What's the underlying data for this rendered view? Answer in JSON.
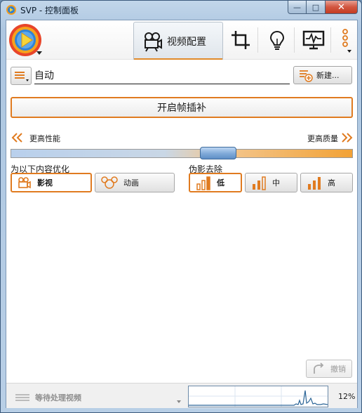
{
  "window": {
    "title": "SVP - 控制面板",
    "buttons": {
      "minimize": "—",
      "maximize": "□",
      "close": "✕"
    }
  },
  "header": {
    "active_tab": "视频配置",
    "tabs": [
      {
        "id": "video-profiles",
        "label": "视频配置",
        "icon": "video-camera-icon"
      },
      {
        "id": "crop",
        "label": "",
        "icon": "crop-icon"
      },
      {
        "id": "tips",
        "label": "",
        "icon": "lightbulb-icon"
      },
      {
        "id": "monitor",
        "label": "",
        "icon": "monitor-icon"
      },
      {
        "id": "more",
        "label": "",
        "icon": "more-vertical-icon"
      }
    ]
  },
  "profile": {
    "name": "自动",
    "new_button_label": "新建...",
    "enable_button_label": "开启帧插补"
  },
  "slider": {
    "left_label": "更高性能",
    "right_label": "更高质量",
    "value_percent": 62
  },
  "optimize": {
    "label": "为以下内容优化",
    "options": [
      {
        "label": "影视",
        "icon": "film-camera-icon",
        "selected": true
      },
      {
        "label": "动画",
        "icon": "mickey-mouse-icon",
        "selected": false
      }
    ]
  },
  "artifacts": {
    "label": "伪影去除",
    "options": [
      {
        "label": "低",
        "selected": true
      },
      {
        "label": "中",
        "selected": false
      },
      {
        "label": "高",
        "selected": false
      }
    ]
  },
  "undo_label": "撤销",
  "status": {
    "text": "等待处理视频",
    "cpu": "12%"
  },
  "colors": {
    "accent_orange": "#e07b20",
    "slider_thumb_blue": "#7fa9d8"
  }
}
